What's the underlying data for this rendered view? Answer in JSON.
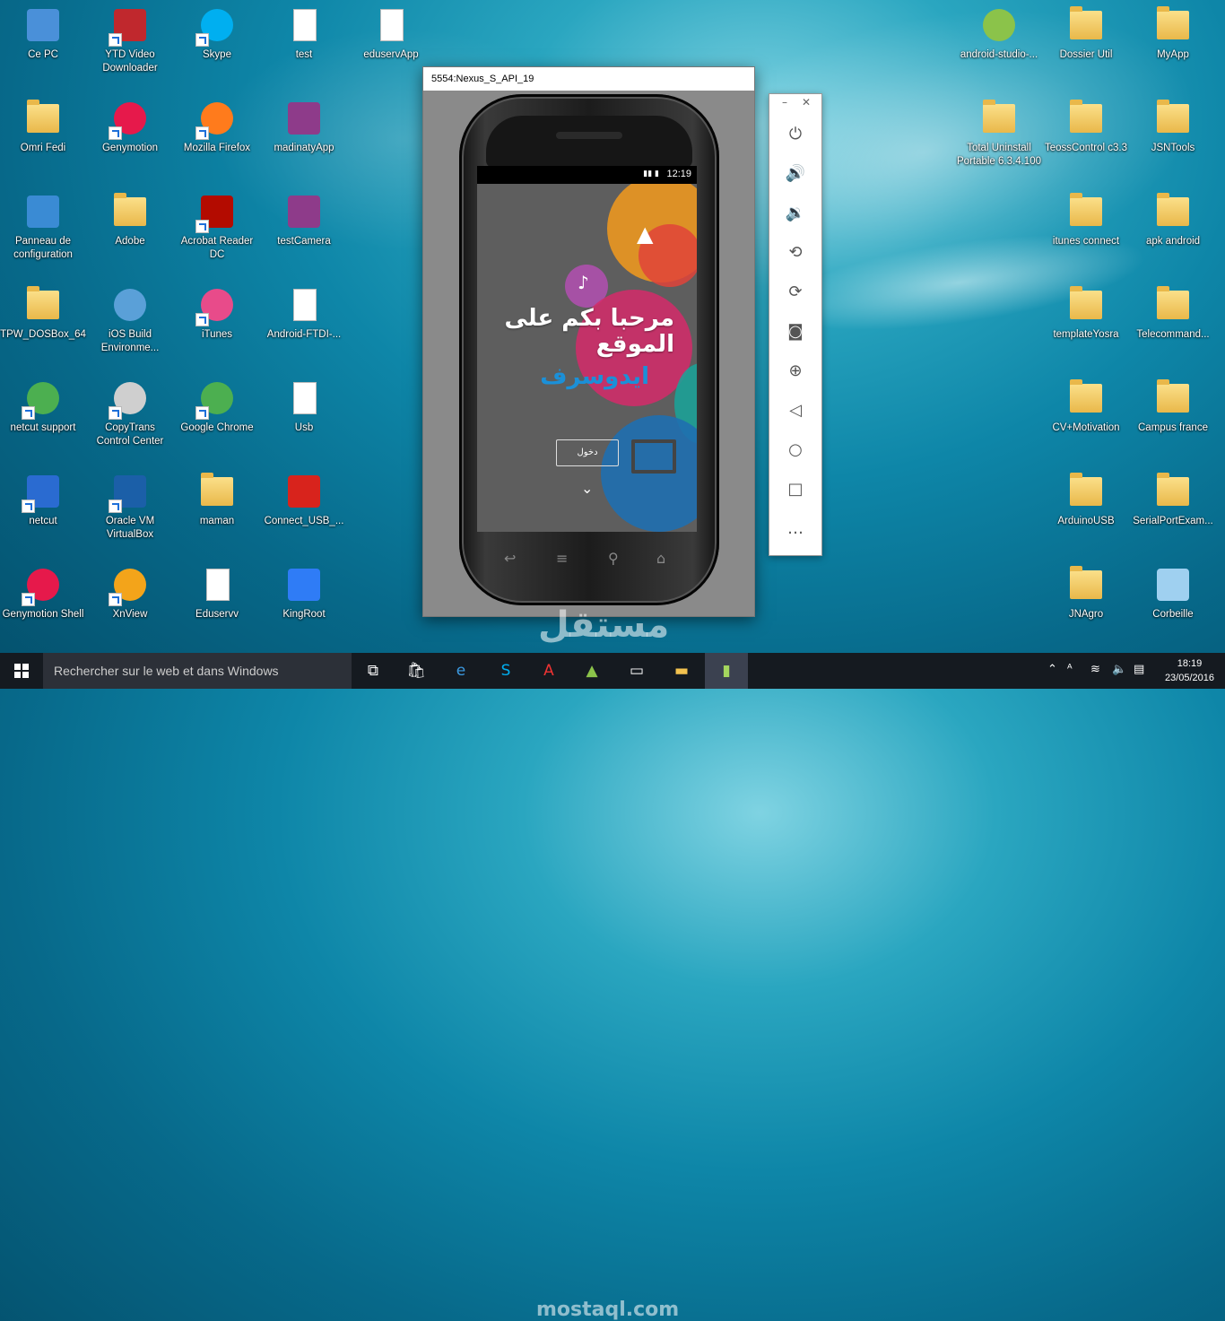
{
  "desktop": {
    "icons": [
      {
        "label": "Ce PC",
        "icon": "computer-icon"
      },
      {
        "label": "YTD Video Downloader",
        "icon": "downloader-icon"
      },
      {
        "label": "Skype",
        "icon": "skype-icon"
      },
      {
        "label": "test",
        "icon": "document-icon"
      },
      {
        "label": "eduservApp",
        "icon": "document-icon"
      },
      {
        "label": "Omri Fedi",
        "icon": "user-folder-icon"
      },
      {
        "label": "Genymotion",
        "icon": "genymotion-icon"
      },
      {
        "label": "Mozilla Firefox",
        "icon": "firefox-icon"
      },
      {
        "label": "madinatyApp",
        "icon": "archive-icon"
      },
      {
        "label": "Panneau de configuration",
        "icon": "control-panel-icon"
      },
      {
        "label": "Adobe",
        "icon": "adobe-folder-icon"
      },
      {
        "label": "Acrobat Reader DC",
        "icon": "acrobat-icon"
      },
      {
        "label": "testCamera",
        "icon": "archive-icon"
      },
      {
        "label": "TPW_DOSBox_64",
        "icon": "folder-icon"
      },
      {
        "label": "iOS Build Environme...",
        "icon": "ios-build-icon"
      },
      {
        "label": "iTunes",
        "icon": "itunes-icon"
      },
      {
        "label": "Android-FTDI-...",
        "icon": "document-icon"
      },
      {
        "label": "netcut support",
        "icon": "chrome-icon"
      },
      {
        "label": "CopyTrans Control Center",
        "icon": "copytrans-icon"
      },
      {
        "label": "Google Chrome",
        "icon": "chrome-icon"
      },
      {
        "label": "Usb",
        "icon": "document-icon"
      },
      {
        "label": "netcut",
        "icon": "scissors-icon"
      },
      {
        "label": "Oracle VM VirtualBox",
        "icon": "virtualbox-icon"
      },
      {
        "label": "maman",
        "icon": "archive-folder-icon"
      },
      {
        "label": "Connect_USB_...",
        "icon": "pdf-icon"
      },
      {
        "label": "Genymotion Shell",
        "icon": "genymotion-shell-icon"
      },
      {
        "label": "XnView",
        "icon": "xnview-icon"
      },
      {
        "label": "Eduservv",
        "icon": "document-icon"
      },
      {
        "label": "KingRoot",
        "icon": "kingroot-icon"
      },
      {
        "label": "android-studio-...",
        "icon": "android-studio-icon"
      },
      {
        "label": "Dossier Util",
        "icon": "folder-icon"
      },
      {
        "label": "MyApp",
        "icon": "folder-icon"
      },
      {
        "label": "Total Uninstall Portable 6.3.4.100",
        "icon": "folder-icon"
      },
      {
        "label": "TeossControl c3.3",
        "icon": "folder-icon"
      },
      {
        "label": "JSNTools",
        "icon": "folder-icon"
      },
      {
        "label": "itunes connect",
        "icon": "folder-icon"
      },
      {
        "label": "apk android",
        "icon": "folder-icon"
      },
      {
        "label": "templateYosra",
        "icon": "chrome-folder-icon"
      },
      {
        "label": "Telecommand...",
        "icon": "folder-check-icon"
      },
      {
        "label": "CV+Motivation",
        "icon": "folder-icon"
      },
      {
        "label": "Campus france",
        "icon": "pdf-folder-icon"
      },
      {
        "label": "ArduinoUSB",
        "icon": "folder-icon"
      },
      {
        "label": "SerialPortExam...",
        "icon": "folder-icon"
      },
      {
        "label": "JNAgro",
        "icon": "folder-warning-icon"
      },
      {
        "label": "Corbeille",
        "icon": "recycle-bin-icon"
      }
    ]
  },
  "emulator": {
    "title": "5554:Nexus_S_API_19",
    "status_time": "12:19",
    "app": {
      "welcome": "مرحبا بكم على الموقع",
      "brand": "ايدوسرف",
      "login_button": "دخول"
    }
  },
  "toolbar": {
    "buttons": [
      "power",
      "volume-up",
      "volume-down",
      "rotate-left",
      "rotate-right",
      "camera",
      "zoom",
      "back",
      "home",
      "overview",
      "more"
    ]
  },
  "taskbar": {
    "search_placeholder": "Rechercher sur le web et dans Windows",
    "time": "18:19",
    "date": "23/05/2016"
  },
  "watermark": {
    "arabic": "مستقل",
    "latin": "mostaql.com"
  },
  "colors": {
    "brand": "#1b90d8",
    "taskbar": "#151a20"
  }
}
